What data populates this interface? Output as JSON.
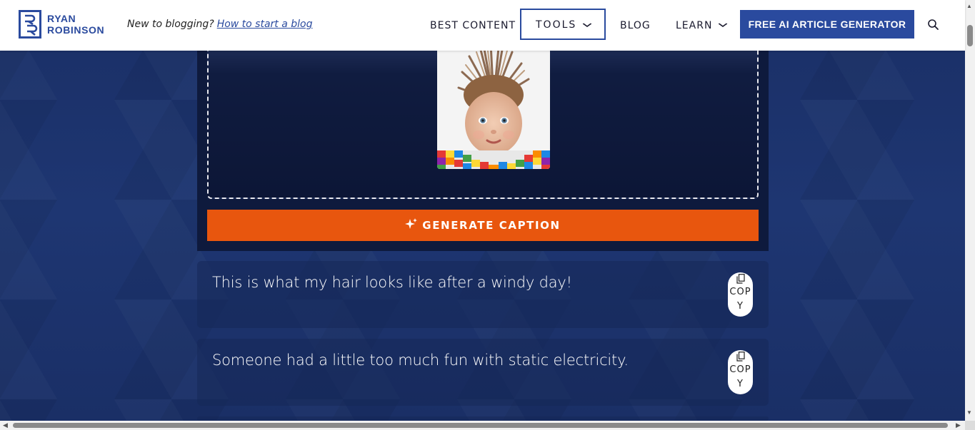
{
  "header": {
    "logo_line1": "RYAN",
    "logo_line2": "ROBINSON",
    "tagline": "New to blogging?",
    "tagline_link": "How to start a blog",
    "nav": {
      "best_content": "BEST CONTENT",
      "tools": "TOOLS",
      "blog": "BLOG",
      "learn": "LEARN"
    },
    "cta": "FREE AI ARTICLE GENERATOR",
    "search_icon": "search-icon"
  },
  "uploader": {
    "image_alt": "baby with static hair",
    "generate_label": "GENERATE CAPTION"
  },
  "captions": [
    {
      "text": "This is what my hair looks like after a windy day!",
      "copy_label": "COPY"
    },
    {
      "text": "Someone had a little too much fun with static electricity.",
      "copy_label": "COPY"
    }
  ],
  "colors": {
    "brand_blue": "#2a4a9e",
    "accent_orange": "#e8560e",
    "panel_dark": "#0e1a3d",
    "background": "#1b3169"
  }
}
